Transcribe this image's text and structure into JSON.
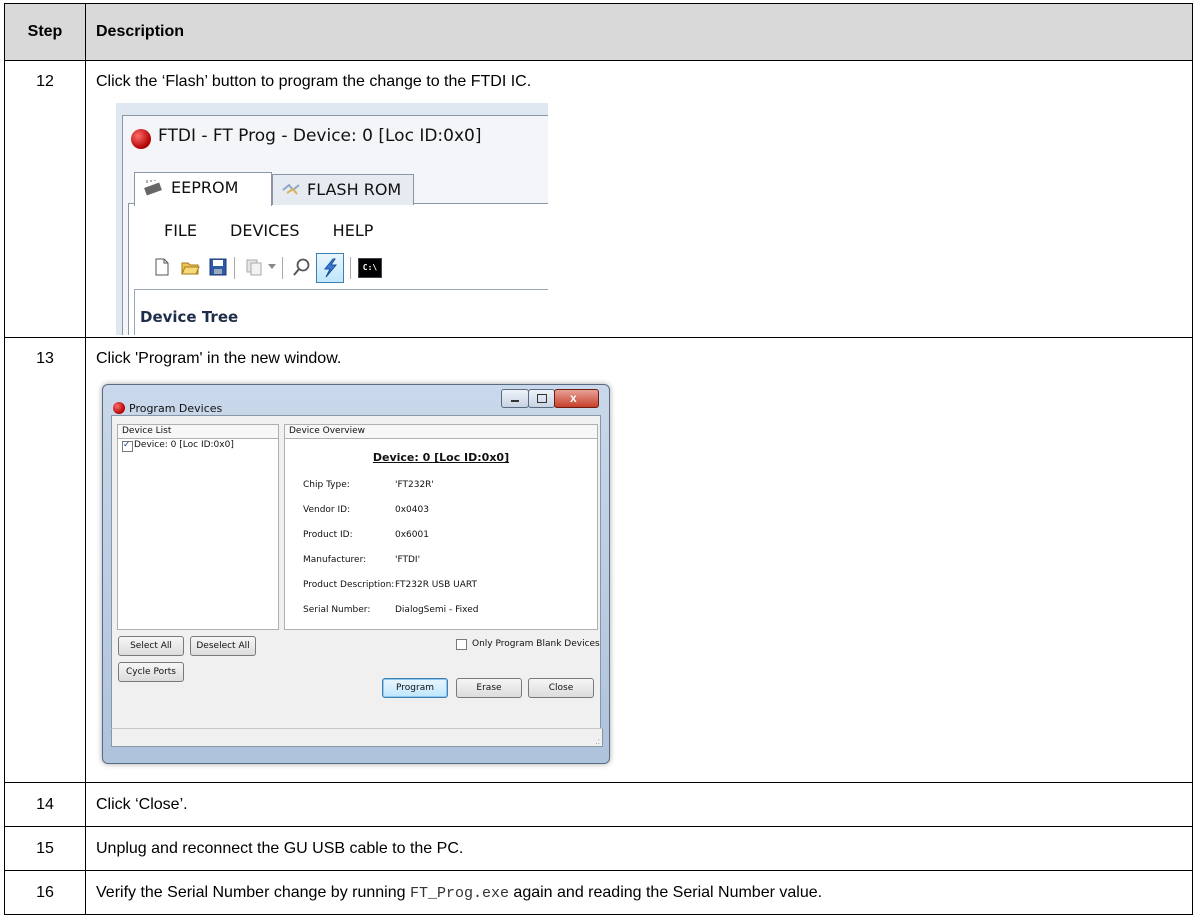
{
  "table": {
    "header": {
      "step": "Step",
      "description": "Description"
    },
    "rows": [
      {
        "step": "12",
        "text": "Click the ‘Flash’ button to program the change to the FTDI IC."
      },
      {
        "step": "13",
        "text": "Click 'Program' in the new window."
      },
      {
        "step": "14",
        "text": "Click ‘Close’."
      },
      {
        "step": "15",
        "text": "Unplug and reconnect the GU USB cable to the PC."
      },
      {
        "step": "16",
        "text_before": "Verify the Serial Number change by running ",
        "code": "FT_Prog.exe",
        "text_after": " again and reading the Serial Number value."
      }
    ]
  },
  "shot_ftprog": {
    "window_title": "FTDI - FT Prog - Device: 0 [Loc ID:0x0]",
    "tabs": [
      "EEPROM",
      "FLASH ROM"
    ],
    "menu": [
      "FILE",
      "DEVICES",
      "HELP"
    ],
    "toolbar_icons": [
      "new-file-icon",
      "open-folder-icon",
      "save-icon",
      "copy-icon",
      "search-icon",
      "flash-icon",
      "cmd-icon"
    ],
    "cmd_label": "C:\\",
    "device_tree_label": "Device Tree"
  },
  "shot_program": {
    "window_title": "Program Devices",
    "device_list_header": "Device List",
    "device_item": "Device: 0 [Loc ID:0x0]",
    "device_overview_header": "Device Overview",
    "overview_title": "Device: 0 [Loc ID:0x0]",
    "fields": [
      {
        "label": "Chip Type:",
        "value": "'FT232R'"
      },
      {
        "label": "Vendor ID:",
        "value": "0x0403"
      },
      {
        "label": "Product ID:",
        "value": "0x6001"
      },
      {
        "label": "Manufacturer:",
        "value": "'FTDI'"
      },
      {
        "label": "Product Description:",
        "value": "FT232R USB UART"
      },
      {
        "label": "Serial Number:",
        "value": "DialogSemi - Fixed"
      }
    ],
    "select_all": "Select All",
    "deselect_all": "Deselect All",
    "cycle_ports": "Cycle Ports",
    "only_blank": "Only Program Blank Devices",
    "program": "Program",
    "erase": "Erase",
    "close": "Close"
  }
}
